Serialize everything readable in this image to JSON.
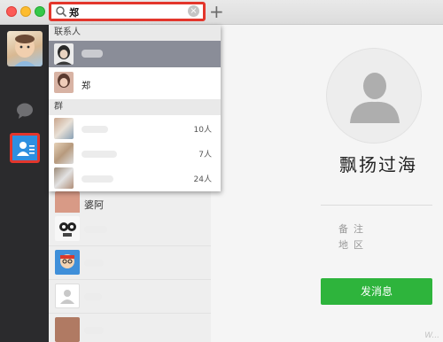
{
  "search": {
    "query": "郑"
  },
  "toolbar": {
    "add_label": "+"
  },
  "dropdown": {
    "contacts_header": "联系人",
    "contacts": [
      {
        "name": ""
      },
      {
        "name": "郑"
      }
    ],
    "groups_header": "群",
    "groups": [
      {
        "count": "10人"
      },
      {
        "count": "7人"
      },
      {
        "count": "24人"
      }
    ]
  },
  "list": {
    "partial_label": "婆阿"
  },
  "profile": {
    "name": "飘扬过海",
    "fields": [
      {
        "label": "备注"
      },
      {
        "label": "地区"
      }
    ],
    "send_button": "发消息"
  },
  "colors": {
    "highlight": "#e3362c",
    "send": "#2eb43c",
    "rail": "#2b2b2d",
    "selected_row": "#8a8d98"
  },
  "watermark": "W..."
}
